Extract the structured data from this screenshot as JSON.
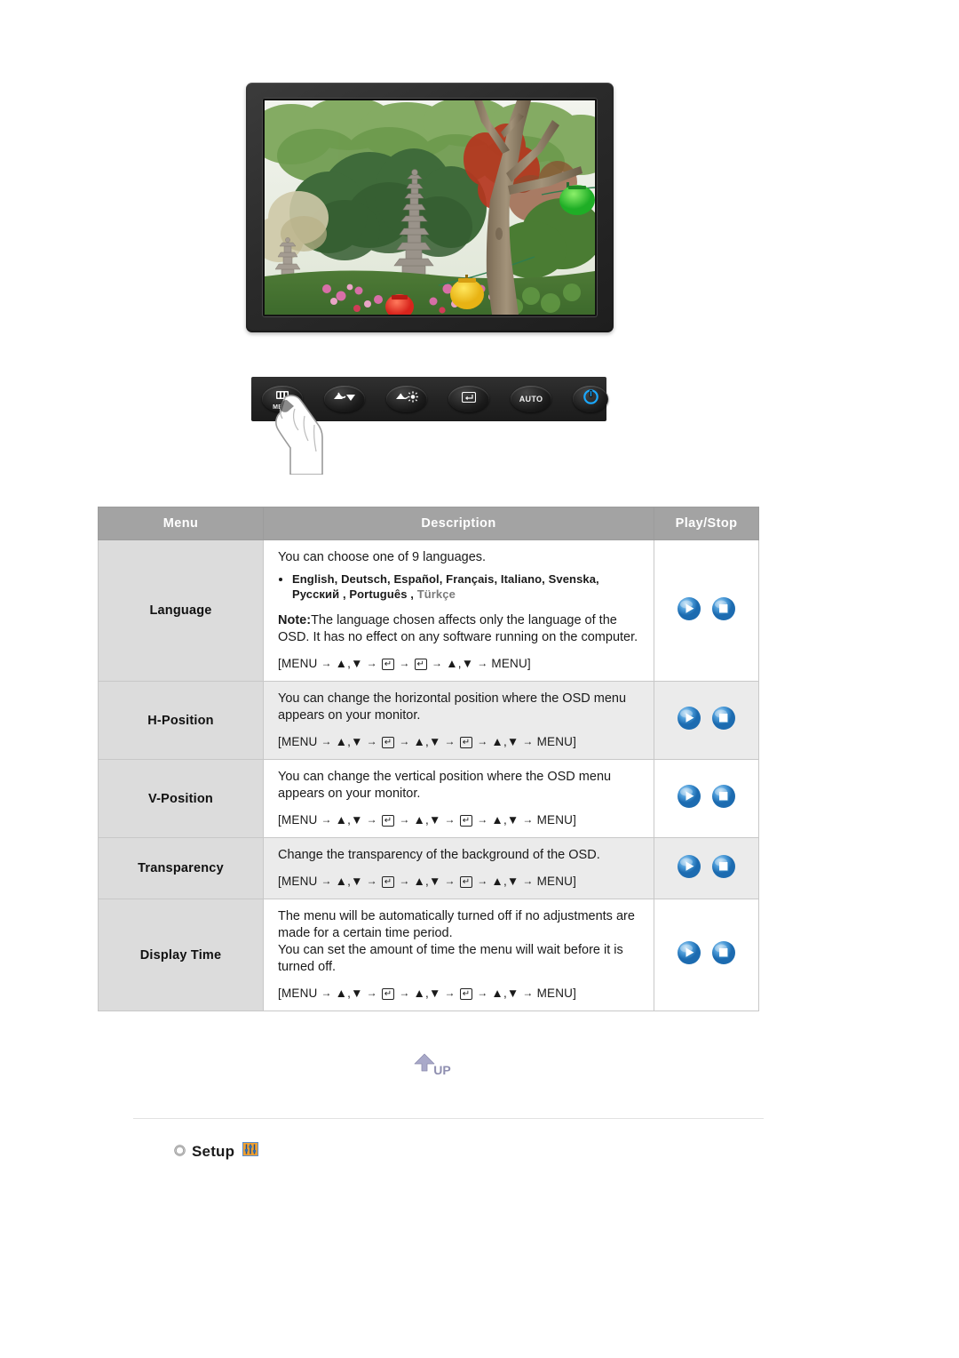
{
  "monitor": {
    "screen_image_alt": "garden-photo-with-stone-pagoda-trees-and-paper-lanterns"
  },
  "control_panel": {
    "buttons": [
      {
        "name": "menu-button",
        "label": "MENU",
        "glyph": "menu-bars-icon"
      },
      {
        "name": "source-down-button",
        "label": "",
        "glyph": "source-down-icon"
      },
      {
        "name": "brightness-up-button",
        "label": "",
        "glyph": "brightness-up-icon"
      },
      {
        "name": "enter-button",
        "label": "",
        "glyph": "enter-key-icon"
      },
      {
        "name": "auto-button",
        "label": "AUTO",
        "glyph": "auto-text-icon"
      },
      {
        "name": "power-button",
        "label": "",
        "glyph": "power-icon"
      }
    ],
    "cursor": "hand-pointing-icon"
  },
  "table": {
    "headers": {
      "menu": "Menu",
      "description": "Description",
      "play_stop": "Play/Stop"
    },
    "rows": [
      {
        "menu": "Language",
        "intro": "You can choose one of 9 languages.",
        "languages_line1": "English, Deutsch, Español, Français,  Italiano, Svenska,",
        "languages_line2_bold": "Русский , Português ,",
        "languages_line2_dim": "Türkçe",
        "note_label": "Note:",
        "note_text": "The language chosen affects only the language of the OSD. It has no effect on any software running on the computer.",
        "shortcut": "[MENU → ▲,▼ → ↵ → ↵ → ▲,▼ → MENU]",
        "shortcut_steps": [
          "MENU",
          "▲,▼",
          "enter",
          "enter",
          "▲,▼",
          "MENU"
        ],
        "play_label": "play-icon",
        "stop_label": "stop-icon"
      },
      {
        "menu": "H-Position",
        "intro": "You can change the horizontal position where the OSD menu appears on your monitor.",
        "shortcut": "[MENU → ▲,▼ → ↵ → ▲,▼ → ↵ → ▲,▼ → MENU]",
        "shortcut_steps": [
          "MENU",
          "▲,▼",
          "enter",
          "▲,▼",
          "enter",
          "▲,▼",
          "MENU"
        ],
        "play_label": "play-icon",
        "stop_label": "stop-icon"
      },
      {
        "menu": "V-Position",
        "intro": "You can change the vertical position where the OSD menu appears on your monitor.",
        "shortcut": "[MENU → ▲,▼ → ↵ → ▲,▼ → ↵ → ▲,▼ → MENU]",
        "shortcut_steps": [
          "MENU",
          "▲,▼",
          "enter",
          "▲,▼",
          "enter",
          "▲,▼",
          "MENU"
        ],
        "play_label": "play-icon",
        "stop_label": "stop-icon"
      },
      {
        "menu": "Transparency",
        "intro": "Change the transparency of the background of the OSD.",
        "shortcut": "[MENU → ▲,▼ → ↵ → ▲,▼ → ↵ → ▲,▼ → MENU]",
        "shortcut_steps": [
          "MENU",
          "▲,▼",
          "enter",
          "▲,▼",
          "enter",
          "▲,▼",
          "MENU"
        ],
        "play_label": "play-icon",
        "stop_label": "stop-icon"
      },
      {
        "menu": "Display Time",
        "intro": "The menu will be automatically turned off if no adjustments are made for a certain time period.",
        "intro2": "You can set the amount of time the menu will wait before it is turned off.",
        "shortcut": "[MENU → ▲,▼ → ↵ → ▲,▼ → ↵ → ▲,▼ → MENU]",
        "shortcut_steps": [
          "MENU",
          "▲,▼",
          "enter",
          "▲,▼",
          "enter",
          "▲,▼",
          "MENU"
        ],
        "play_label": "play-icon",
        "stop_label": "stop-icon"
      }
    ]
  },
  "footer": {
    "up_button_label": "UP",
    "setup_label": "Setup",
    "setup_icon": "setup-sliders-icon"
  },
  "colors": {
    "table_header_bg": "#a3a3a3",
    "menu_column_bg": "#dcdcdc",
    "alt_row_bg": "#ebebeb",
    "play_button_blue": "#3f94d4",
    "setup_icon_orange": "#f0a030",
    "up_arrow_lavender": "#a8a8c8"
  }
}
